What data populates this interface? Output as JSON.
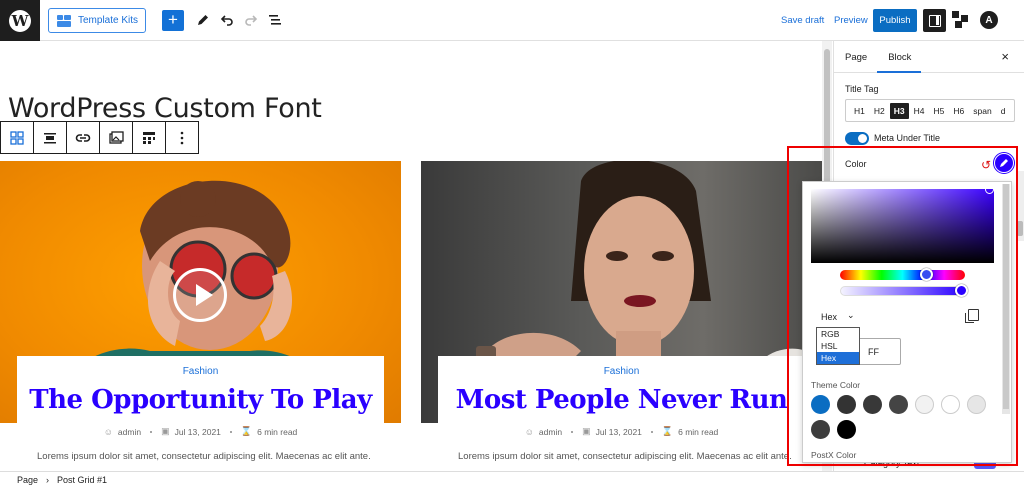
{
  "topbar": {
    "template_kits": "Template Kits",
    "add": "+",
    "save_draft": "Save draft",
    "preview": "Preview",
    "publish": "Publish",
    "astra": "A"
  },
  "canvas": {
    "page_title": "WordPress Custom Font",
    "posts": [
      {
        "category": "Fashion",
        "title": "The Opportunity To Play",
        "author": "admin",
        "date": "Jul 13, 2021",
        "read": "6 min read",
        "excerpt": "Lorems ipsum dolor sit amet, consectetur adipiscing elit. Maecenas ac elit ante."
      },
      {
        "category": "Fashion",
        "title": "Most People Never Run",
        "author": "admin",
        "date": "Jul 13, 2021",
        "read": "6 min read",
        "excerpt": "Lorems ipsum dolor sit amet, consectetur adipiscing elit. Maecenas ac elit ante."
      }
    ]
  },
  "statusbar": {
    "crumb1": "Page",
    "sep": "›",
    "crumb2": "Post Grid #1"
  },
  "sidebar": {
    "tab_page": "Page",
    "tab_block": "Block",
    "close": "×",
    "title_tag_label": "Title Tag",
    "tags": [
      "H1",
      "H2",
      "H3",
      "H4",
      "H5",
      "H6",
      "span",
      "d"
    ],
    "active_tag": "H3",
    "meta_toggle_label": "Meta Under Title",
    "meta_toggle_on": true,
    "color_label": "Color",
    "hidden_row": "Category Text"
  },
  "color_picker": {
    "selected_color": "#2a00ff",
    "format_label": "Hex",
    "format_options": [
      "RGB",
      "HSL",
      "Hex"
    ],
    "selected_format": "Hex",
    "hex_value_visible": "FF",
    "theme_color_label": "Theme Color",
    "theme_colors": [
      "#0a6dc2",
      "#333333",
      "#383838",
      "#444444",
      "#f2f2f2",
      "#ffffff",
      "#e6e6e6",
      "#3d3d3d",
      "#000000"
    ],
    "postx_color_label": "PostX Color"
  }
}
